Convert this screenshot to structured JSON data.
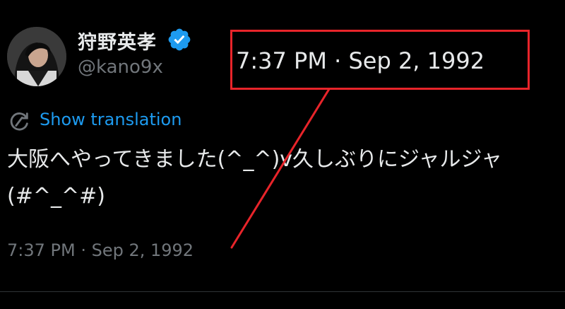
{
  "author": {
    "display_name": "狩野英孝",
    "handle": "@kano9x"
  },
  "translate": {
    "label": "Show translation"
  },
  "tweet": {
    "line1": "大阪へやってきました(^_^)v久しぶりにジャルジャ",
    "line2": "(#^_^#)"
  },
  "timestamp": "7:37 PM · Sep 2, 1992",
  "annotation": {
    "text": "7:37 PM · Sep 2, 1992",
    "color": "#e8242a"
  },
  "colors": {
    "background": "#000000",
    "link": "#1d9bf0",
    "muted": "#71767b",
    "verified": "#1d9bf0"
  }
}
